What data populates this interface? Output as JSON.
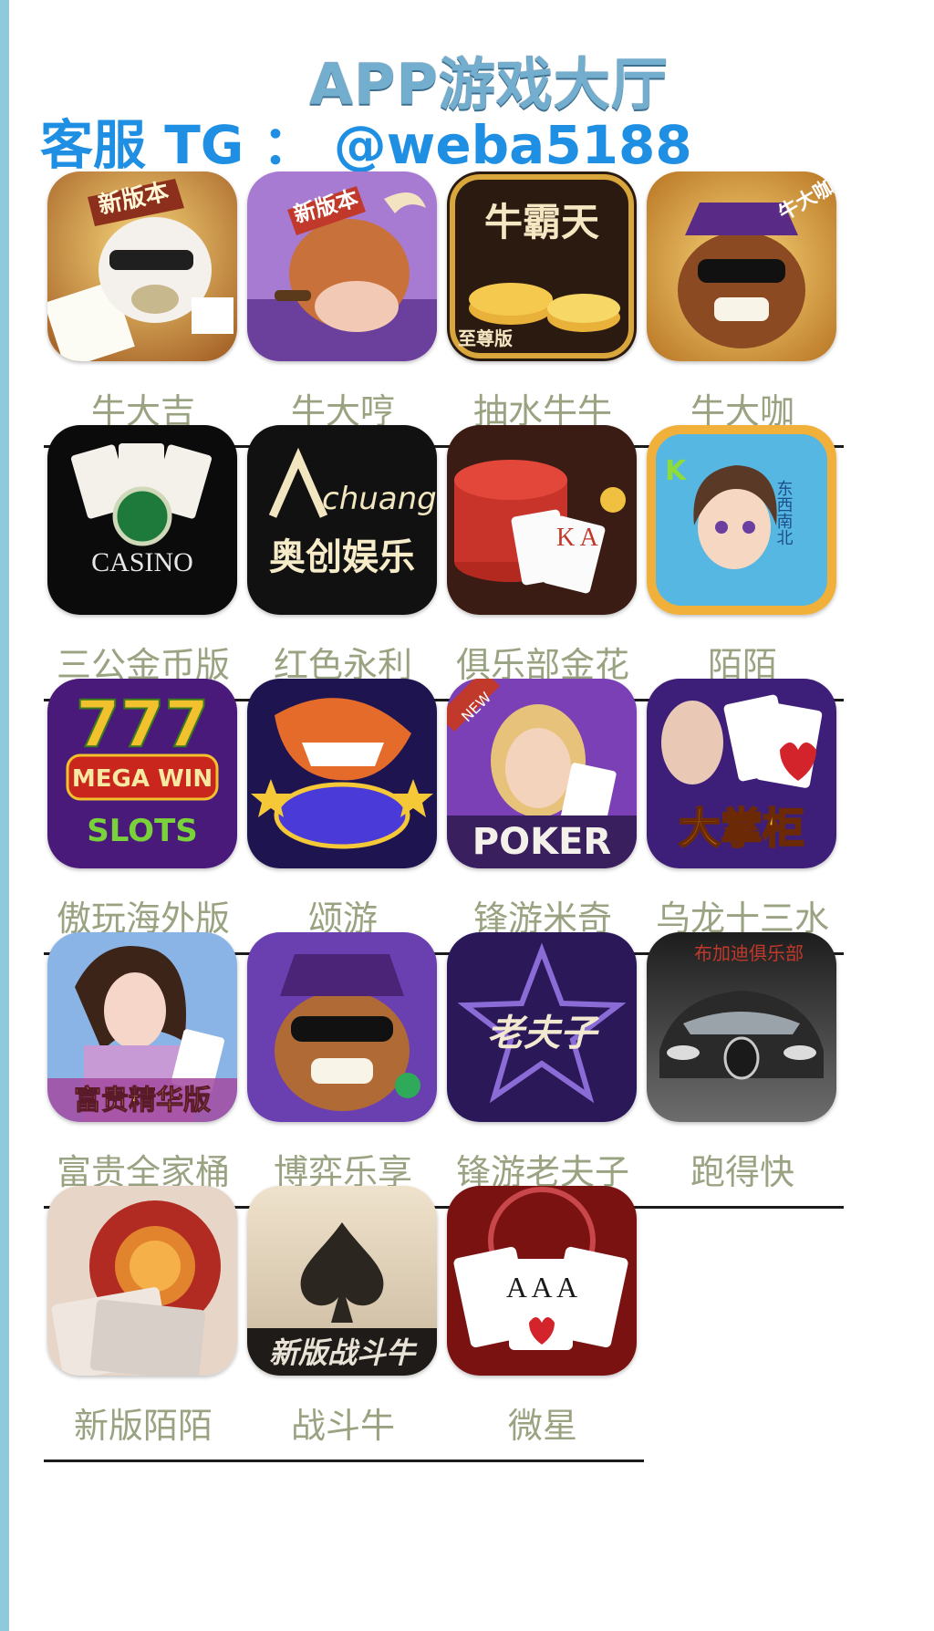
{
  "header": {
    "title": "APP游戏大厅",
    "support": "客服 TG ： @weba5188"
  },
  "apps": [
    {
      "label": "牛大吉",
      "icon": "bull-card-icon",
      "caption": "新版本"
    },
    {
      "label": "牛大哼",
      "icon": "cigar-bull-icon",
      "caption": "新版本"
    },
    {
      "label": "抽水牛牛",
      "icon": "coin-stack-icon",
      "caption": "牛霸天",
      "sub": "至尊版"
    },
    {
      "label": "牛大咖",
      "icon": "sunglasses-bull-icon",
      "caption": "牛大咖"
    },
    {
      "label": "三公金币版",
      "icon": "casino-cards-icon",
      "caption": "CASINO"
    },
    {
      "label": "红色永利",
      "icon": "achuang-logo-icon",
      "caption": "chuang",
      "sub": "奥创娱乐"
    },
    {
      "label": "俱乐部金花",
      "icon": "chips-cards-icon",
      "caption": "K A"
    },
    {
      "label": "陌陌",
      "icon": "mahjong-girl-icon",
      "caption": "东西南北"
    },
    {
      "label": "傲玩海外版",
      "icon": "slots-777-icon",
      "caption": "MEGA WIN",
      "sub": "SLOTS"
    },
    {
      "label": "颂游",
      "icon": "shark-icon",
      "caption": ""
    },
    {
      "label": "锋游米奇",
      "icon": "poker-girl-icon",
      "caption": "POKER",
      "sub": "NEW"
    },
    {
      "label": "乌龙十三水",
      "icon": "cards-lady-icon",
      "caption": "大掌柜"
    },
    {
      "label": "富贵全家桶",
      "icon": "lady-cards-icon",
      "caption": "富贵精华版"
    },
    {
      "label": "博弈乐享",
      "icon": "purple-bull-icon",
      "caption": ""
    },
    {
      "label": "锋游老夫子",
      "icon": "star-logo-icon",
      "caption": "老夫子"
    },
    {
      "label": "跑得快",
      "icon": "sports-car-icon",
      "caption": "布加迪俱乐部"
    },
    {
      "label": "新版陌陌",
      "icon": "red-chip-icon",
      "caption": ""
    },
    {
      "label": "战斗牛",
      "icon": "spade-icon",
      "caption": "新版战斗牛"
    },
    {
      "label": "微星",
      "icon": "three-aces-icon",
      "caption": "A A A"
    }
  ],
  "colors": {
    "title": "#74aece",
    "support": "#1f8fe3",
    "label": "#99a381"
  }
}
